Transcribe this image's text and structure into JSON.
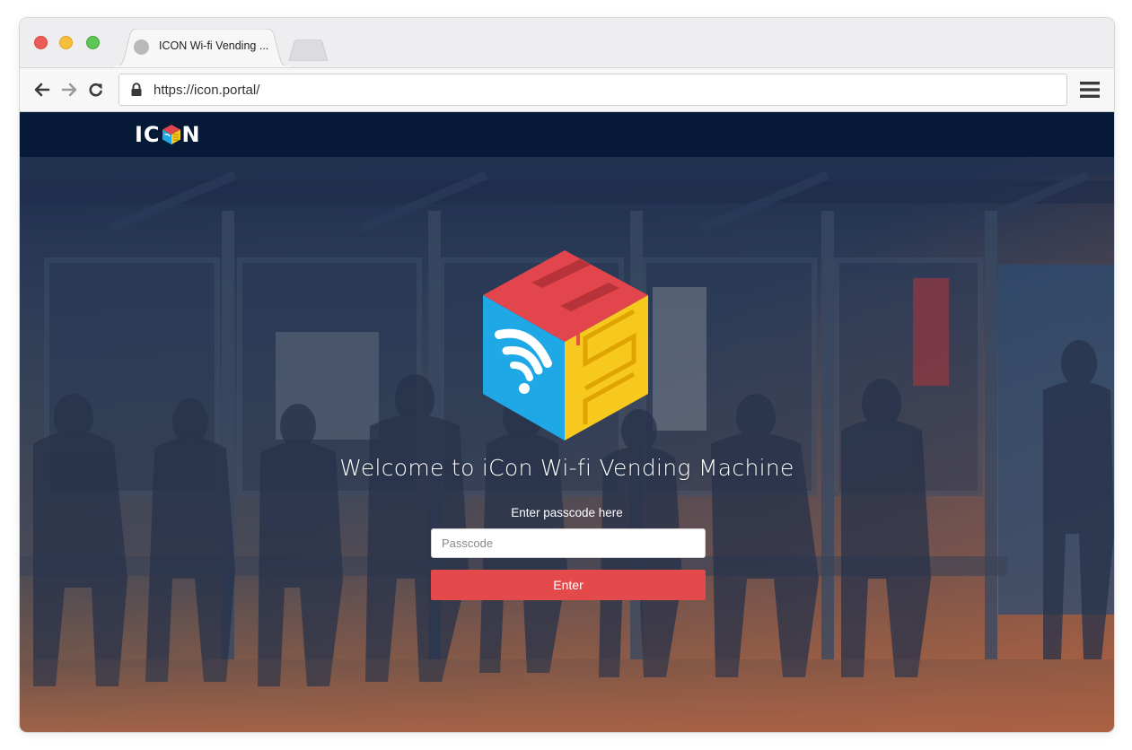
{
  "browser": {
    "tab_title": "ICON Wi-fi Vending ...",
    "url": "https://icon.portal/",
    "icons": [
      "back-arrow-icon",
      "forward-arrow-icon",
      "reload-icon",
      "lock-icon",
      "hamburger-menu-icon"
    ]
  },
  "header": {
    "logo_left": "IC",
    "logo_right": "N"
  },
  "main": {
    "welcome_text": "Welcome to iCon Wi-fi Vending Machine",
    "passcode_label": "Enter passcode here",
    "passcode_placeholder": "Passcode",
    "passcode_value": "",
    "enter_button": "Enter"
  },
  "colors": {
    "header_bg": "#061a37",
    "button": "#e44a4b",
    "logo_red": "#e2464c",
    "logo_blue": "#1fa8e6",
    "logo_yellow": "#f7c81e"
  }
}
